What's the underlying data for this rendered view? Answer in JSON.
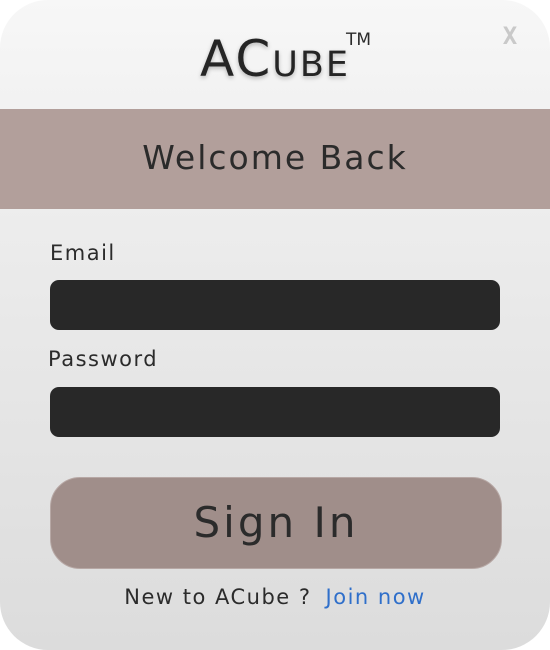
{
  "app": {
    "brand": "ACube",
    "trademark": "TM",
    "close_label": "X"
  },
  "banner": {
    "title": "Welcome Back"
  },
  "form": {
    "email_label": "Email",
    "email_value": "",
    "password_label": "Password",
    "password_value": "",
    "submit_label": "Sign In"
  },
  "footer": {
    "prompt": "New to ACube ?",
    "join_label": "Join now"
  },
  "colors": {
    "banner": "#b29f9b",
    "button": "#a08e8a",
    "field": "#282828",
    "link": "#2f6fca",
    "close": "#c9c9c9"
  }
}
